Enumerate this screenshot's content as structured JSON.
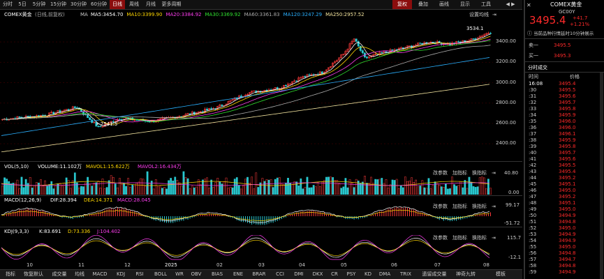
{
  "colors": {
    "up": "#ff3b3b",
    "down": "#29c8cf",
    "ma5": "#ffffff",
    "ma10": "#ffd700",
    "ma20": "#ff3df0",
    "ma30": "#30e030",
    "ma60": "#aaaaaa",
    "ma120": "#2ab0ff",
    "ma250": "#f5e6a0",
    "accent_red": "#ff2a2a",
    "bg": "#000000"
  },
  "toolbar": {
    "periods": [
      "分时",
      "5日",
      "5分钟",
      "15分钟",
      "30分钟",
      "60分钟",
      "日线",
      "周线",
      "月线",
      "更多周期"
    ],
    "active_period": "日线",
    "right": [
      "复权",
      "叠加",
      "画线",
      "显示",
      "工具"
    ],
    "active_right": "复权"
  },
  "chart_header": {
    "name": "COMEX黄金",
    "adj": "(日线,前复权)",
    "ma_label": "MA",
    "ma": [
      {
        "k": "MA5",
        "v": "3454.70"
      },
      {
        "k": "MA10",
        "v": "3399.90"
      },
      {
        "k": "MA20",
        "v": "3384.92"
      },
      {
        "k": "MA30",
        "v": "3369.92"
      },
      {
        "k": "MA60",
        "v": "3361.83"
      },
      {
        "k": "MA120",
        "v": "3247.29"
      },
      {
        "k": "MA250",
        "v": "2957.52"
      }
    ],
    "settings": "设置均线"
  },
  "main_chart": {
    "y_ticks": [
      "3400.00",
      "3200.00",
      "3000.00",
      "2800.00",
      "2600.00",
      "2400.00"
    ],
    "high_label": "3534.1",
    "low_label": "2541.5"
  },
  "vol": {
    "label": "VOL(5,10)",
    "volume": "VOLUME:11.102万",
    "mavol1": "MAVOL1:15.622万",
    "mavol2": "MAVOL2:16.434万",
    "y_ticks": [
      "40.80",
      "0.00"
    ]
  },
  "macd": {
    "label": "MACD(12,26,9)",
    "dif": "DIF:28.394",
    "dea": "DEA:14.371",
    "macd": "MACD:28.045",
    "y_ticks": [
      "99.17",
      "-51.72"
    ]
  },
  "kdj": {
    "label": "KDJ(9,3,3)",
    "k": "K:83.691",
    "d": "D:73.336",
    "j": "J:104.402",
    "y_ticks": [
      "115.7",
      "-12.1"
    ]
  },
  "indicator_btns": [
    "改参数",
    "加指标",
    "换指标"
  ],
  "x_axis": [
    "10",
    "11",
    "12",
    "2025",
    "02",
    "03",
    "04",
    "05",
    "06",
    "07",
    "08"
  ],
  "bottom_tabs": [
    "指标",
    "恢复默认",
    "成交量",
    "均线",
    "MACD",
    "KDJ",
    "RSI",
    "BOLL",
    "WR",
    "OBV",
    "BIAS",
    "ENE",
    "BRAR",
    "CCI",
    "DMI",
    "DKX",
    "CR",
    "PSY",
    "KD",
    "DMA",
    "TRIX",
    "遗留成交量",
    "神奇九转"
  ],
  "bottom_right": "模板",
  "quote": {
    "name": "COMEX黄金",
    "code": "GC00Y",
    "price": "3495.4",
    "change": "+41.7",
    "pct": "+1.21%",
    "notice": "当前品种行情延时10分钟展示",
    "ask_label": "卖一",
    "ask": "3495.5",
    "bid_label": "买一",
    "bid": "3495.3"
  },
  "trades": {
    "title": "分时成交",
    "col_time": "时间",
    "col_price": "价格",
    "rows": [
      [
        "16:08",
        "3495.4"
      ],
      [
        ":30",
        "3495.5"
      ],
      [
        ":31",
        "3495.6"
      ],
      [
        ":32",
        "3495.7"
      ],
      [
        ":33",
        "3495.8"
      ],
      [
        ":34",
        "3495.9"
      ],
      [
        ":35",
        "3496.0"
      ],
      [
        ":36",
        "3496.0"
      ],
      [
        ":37",
        "3496.1"
      ],
      [
        ":38",
        "3495.9"
      ],
      [
        ":39",
        "3495.8"
      ],
      [
        ":40",
        "3495.7"
      ],
      [
        ":41",
        "3495.6"
      ],
      [
        ":42",
        "3495.5"
      ],
      [
        ":43",
        "3495.4"
      ],
      [
        ":44",
        "3495.2"
      ],
      [
        ":45",
        "3495.1"
      ],
      [
        ":46",
        "3495.0"
      ],
      [
        ":47",
        "3495.2"
      ],
      [
        ":48",
        "3495.1"
      ],
      [
        ":49",
        "3495.0"
      ],
      [
        ":50",
        "3494.9"
      ],
      [
        ":51",
        "3494.8"
      ],
      [
        ":52",
        "3495.0"
      ],
      [
        ":53",
        "3494.9"
      ],
      [
        ":54",
        "3494.9"
      ],
      [
        ":55",
        "3495.0"
      ],
      [
        ":56",
        "3494.8"
      ],
      [
        ":57",
        "3494.7"
      ],
      [
        ":58",
        "3494.8"
      ],
      [
        ":59",
        "3494.9"
      ]
    ]
  }
}
